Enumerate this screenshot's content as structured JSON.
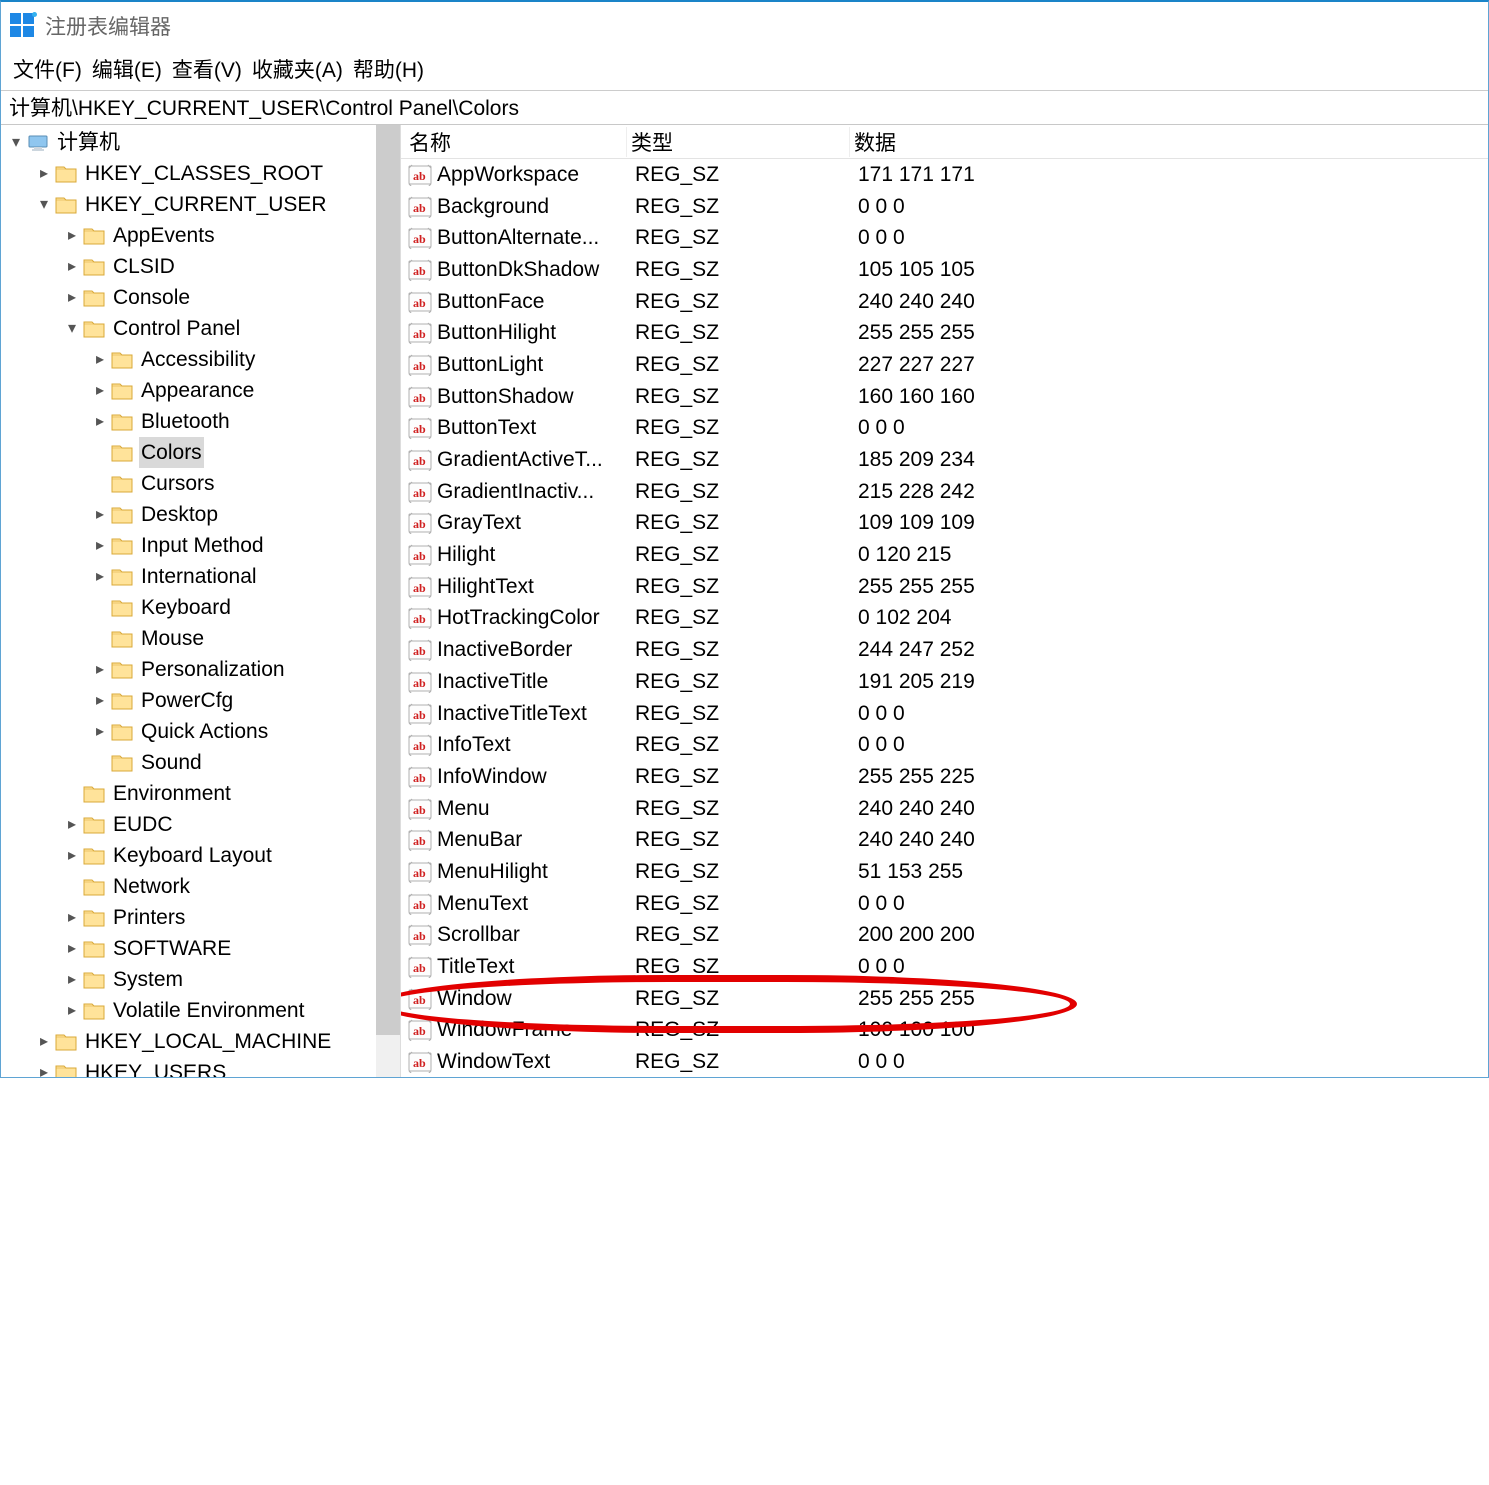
{
  "titlebar": {
    "title": "注册表编辑器"
  },
  "menu": {
    "file": "文件(F)",
    "edit": "编辑(E)",
    "view": "查看(V)",
    "favorites": "收藏夹(A)",
    "help": "帮助(H)"
  },
  "address": "计算机\\HKEY_CURRENT_USER\\Control Panel\\Colors",
  "list": {
    "headers": {
      "name": "名称",
      "type": "类型",
      "data": "数据"
    }
  },
  "tree": {
    "root": "计算机",
    "hkcr": "HKEY_CLASSES_ROOT",
    "hkcu": "HKEY_CURRENT_USER",
    "hkcu_children": {
      "appevents": "AppEvents",
      "clsid": "CLSID",
      "console": "Console",
      "controlpanel": "Control Panel",
      "cp_children": {
        "accessibility": "Accessibility",
        "appearance": "Appearance",
        "bluetooth": "Bluetooth",
        "colors": "Colors",
        "cursors": "Cursors",
        "desktop": "Desktop",
        "inputmethod": "Input Method",
        "international": "International",
        "keyboard": "Keyboard",
        "mouse": "Mouse",
        "personalization": "Personalization",
        "powercfg": "PowerCfg",
        "quickactions": "Quick Actions",
        "sound": "Sound"
      },
      "environment": "Environment",
      "eudc": "EUDC",
      "keyboardlayout": "Keyboard Layout",
      "network": "Network",
      "printers": "Printers",
      "software": "SOFTWARE",
      "system": "System",
      "volatileenv": "Volatile Environment"
    },
    "hklm": "HKEY_LOCAL_MACHINE",
    "hku": "HKEY_USERS"
  },
  "values": [
    {
      "name": "AppWorkspace",
      "type": "REG_SZ",
      "data": "171 171 171"
    },
    {
      "name": "Background",
      "type": "REG_SZ",
      "data": "0 0 0"
    },
    {
      "name": "ButtonAlternate...",
      "type": "REG_SZ",
      "data": "0 0 0"
    },
    {
      "name": "ButtonDkShadow",
      "type": "REG_SZ",
      "data": "105 105 105"
    },
    {
      "name": "ButtonFace",
      "type": "REG_SZ",
      "data": "240 240 240"
    },
    {
      "name": "ButtonHilight",
      "type": "REG_SZ",
      "data": "255 255 255"
    },
    {
      "name": "ButtonLight",
      "type": "REG_SZ",
      "data": "227 227 227"
    },
    {
      "name": "ButtonShadow",
      "type": "REG_SZ",
      "data": "160 160 160"
    },
    {
      "name": "ButtonText",
      "type": "REG_SZ",
      "data": "0 0 0"
    },
    {
      "name": "GradientActiveT...",
      "type": "REG_SZ",
      "data": "185 209 234"
    },
    {
      "name": "GradientInactiv...",
      "type": "REG_SZ",
      "data": "215 228 242"
    },
    {
      "name": "GrayText",
      "type": "REG_SZ",
      "data": "109 109 109"
    },
    {
      "name": "Hilight",
      "type": "REG_SZ",
      "data": "0 120 215"
    },
    {
      "name": "HilightText",
      "type": "REG_SZ",
      "data": "255 255 255"
    },
    {
      "name": "HotTrackingColor",
      "type": "REG_SZ",
      "data": "0 102 204"
    },
    {
      "name": "InactiveBorder",
      "type": "REG_SZ",
      "data": "244 247 252"
    },
    {
      "name": "InactiveTitle",
      "type": "REG_SZ",
      "data": "191 205 219"
    },
    {
      "name": "InactiveTitleText",
      "type": "REG_SZ",
      "data": "0 0 0"
    },
    {
      "name": "InfoText",
      "type": "REG_SZ",
      "data": "0 0 0"
    },
    {
      "name": "InfoWindow",
      "type": "REG_SZ",
      "data": "255 255 225"
    },
    {
      "name": "Menu",
      "type": "REG_SZ",
      "data": "240 240 240"
    },
    {
      "name": "MenuBar",
      "type": "REG_SZ",
      "data": "240 240 240"
    },
    {
      "name": "MenuHilight",
      "type": "REG_SZ",
      "data": "51 153 255"
    },
    {
      "name": "MenuText",
      "type": "REG_SZ",
      "data": "0 0 0"
    },
    {
      "name": "Scrollbar",
      "type": "REG_SZ",
      "data": "200 200 200"
    },
    {
      "name": "TitleText",
      "type": "REG_SZ",
      "data": "0 0 0"
    },
    {
      "name": "Window",
      "type": "REG_SZ",
      "data": "255 255 255"
    },
    {
      "name": "WindowFrame",
      "type": "REG_SZ",
      "data": "100 100 100"
    },
    {
      "name": "WindowText",
      "type": "REG_SZ",
      "data": "0 0 0"
    }
  ]
}
